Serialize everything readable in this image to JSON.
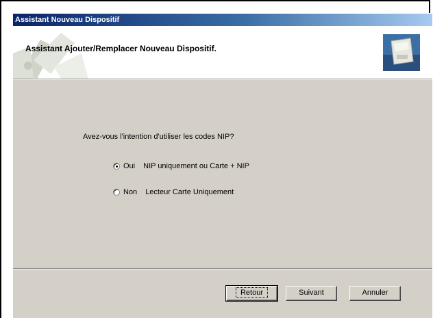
{
  "window": {
    "title": "Assistant Nouveau Dispositif"
  },
  "header": {
    "title": "Assistant Ajouter/Remplacer Nouveau Dispositif.",
    "icon": "device-wizard-icon"
  },
  "main": {
    "question": "Avez-vous l'intention d'utiliser les codes NIP?",
    "options": [
      {
        "value": "Oui",
        "description": "NIP uniquement ou Carte + NIP",
        "selected": true
      },
      {
        "value": "Non",
        "description": "Lecteur Carte Uniquement",
        "selected": false
      }
    ]
  },
  "buttons": {
    "back": "Retour",
    "next": "Suivant",
    "cancel": "Annuler"
  },
  "colors": {
    "dialog_bg": "#d4d0c8",
    "title_bar": "#0a246a"
  }
}
